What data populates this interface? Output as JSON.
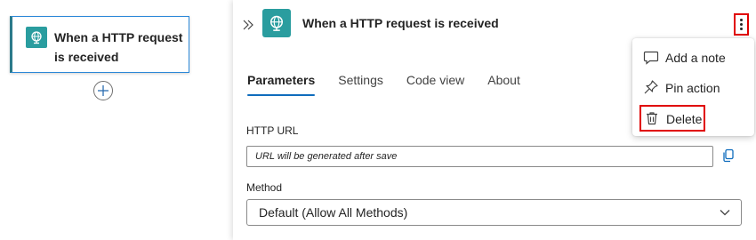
{
  "canvas": {
    "trigger_title": "When a HTTP request is received",
    "add_step_icon": "plus-icon"
  },
  "panel": {
    "title": "When a HTTP request is received",
    "collapse_icon": "double-chevron-right-icon",
    "more_icon": "more-vertical-icon",
    "tabs": [
      {
        "label": "Parameters",
        "active": true
      },
      {
        "label": "Settings",
        "active": false
      },
      {
        "label": "Code view",
        "active": false
      },
      {
        "label": "About",
        "active": false
      }
    ],
    "http_url": {
      "label": "HTTP URL",
      "value": "URL will be generated after save",
      "copy_icon": "copy-icon"
    },
    "method": {
      "label": "Method",
      "value": "Default (Allow All Methods)"
    }
  },
  "menu": {
    "items": [
      {
        "label": "Add a note",
        "icon": "note-icon"
      },
      {
        "label": "Pin action",
        "icon": "pin-icon"
      },
      {
        "label": "Delete",
        "icon": "trash-icon"
      }
    ]
  },
  "colors": {
    "accent": "#0f6cbd",
    "tile": "#2a9d9f",
    "highlight_outline": "#e00000"
  }
}
